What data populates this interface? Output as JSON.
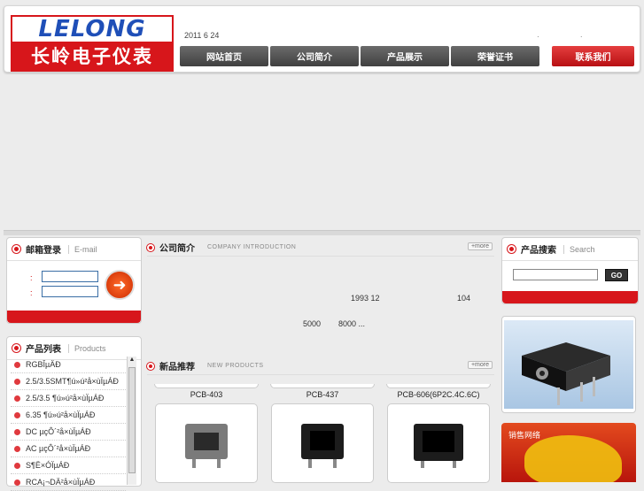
{
  "header": {
    "logo_en": "LELONG",
    "logo_cn": "长岭电子仪表",
    "date_text": "2011 6 24",
    "dots": "· ·",
    "nav": [
      "网站首页",
      "公司简介",
      "产品展示",
      "荣誉证书"
    ],
    "nav_contact": "联系我们"
  },
  "login": {
    "title": "邮箱登录",
    "subtitle": "E-mail",
    "label1": ":",
    "label2": ":",
    "go_icon": "arrow-right-icon"
  },
  "products": {
    "title": "产品列表",
    "subtitle": "Products",
    "items": [
      "RGBÎµÄÐ",
      "2.5/3.5SMT¶ú»ú²å×ùÏµÁÐ",
      "2.5/3.5 ¶ú»ú²å×ùÏµÁÐ",
      "6.35 ¶ú»ú²å×ùÏµÁÐ",
      "DC µçÔ´²å×ùÏµÁÐ",
      "AC µçÔ´²å×ùÏµÁÐ",
      "S¶Ë×ÓÏµÁÐ",
      "RCA¡¬DÄ²å×ùÏµÁÐ"
    ]
  },
  "intro": {
    "title": "公司简介",
    "subtitle": "COMPANY INTRODUCTION",
    "more": "+more",
    "line1a": "1993 12",
    "line1b": "104",
    "line2a": "5000",
    "line2b": "8000 ..."
  },
  "newprod": {
    "title": "新品推荐",
    "subtitle": "NEW PRODUCTS",
    "more": "+more",
    "names": [
      "PCB-403",
      "PCB-437",
      "PCB-606(6P2C.4C.6C)"
    ]
  },
  "search": {
    "title": "产品搜索",
    "subtitle": "Search",
    "go": "GO"
  },
  "map": {
    "label": "销售网络"
  },
  "colors": {
    "brand_red": "#d7161b",
    "logo_blue": "#1f4fb8",
    "nav_dark": "#404040"
  }
}
